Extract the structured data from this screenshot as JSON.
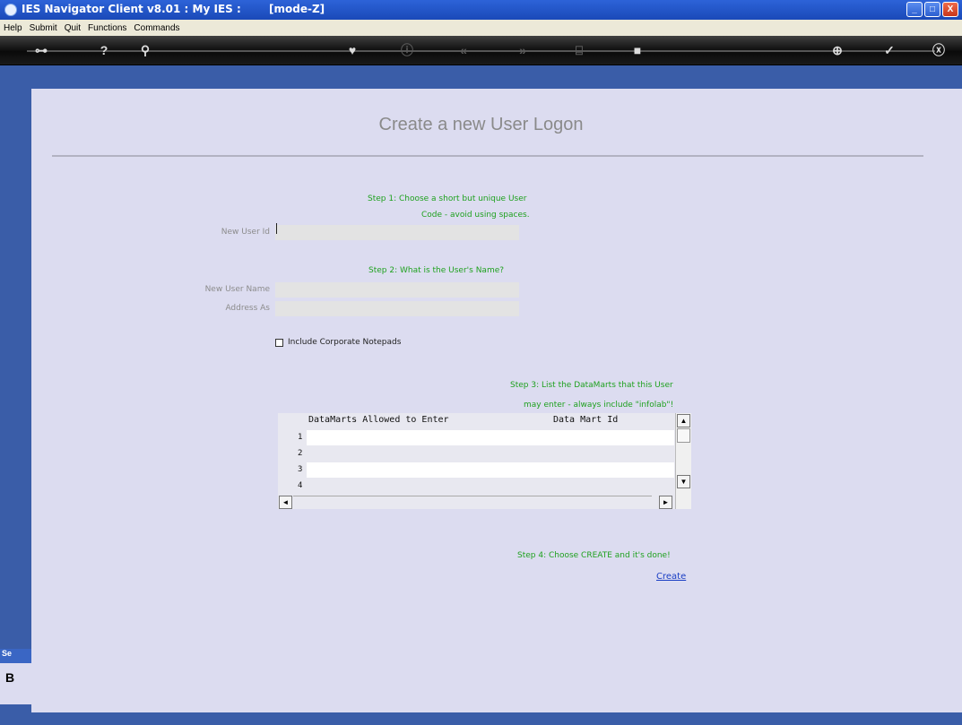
{
  "window": {
    "title": "IES Navigator Client v8.01 : My IES :",
    "mode": "[mode-Z]",
    "controls": {
      "minimize": "_",
      "maximize": "□",
      "close": "X"
    }
  },
  "menu": {
    "items": [
      "Help",
      "Submit",
      "Quit",
      "Functions",
      "Commands"
    ]
  },
  "toolbar": {
    "icons": [
      "key-icon",
      "help-icon",
      "search-icon",
      "heart-icon",
      "info-icon",
      "back-icon",
      "forward-icon",
      "tree-icon",
      "stop-icon",
      "add-icon",
      "check-icon",
      "close-icon"
    ],
    "glyphs": {
      "key": "⊶",
      "help": "?",
      "search": "⚲",
      "heart": "♥",
      "info": "ⓘ",
      "back": "«",
      "forward": "»",
      "tree": "⌸",
      "stop": "■",
      "add": "⊕",
      "check": "✓",
      "close": "ⓧ"
    }
  },
  "side_panel": {
    "header": "Se",
    "icon": "B"
  },
  "form": {
    "heading": "Create a new User Logon",
    "step1_line1": "Step 1: Choose a short but unique User",
    "step1_line2": "Code - avoid using spaces.",
    "new_user_id_label": "New User Id",
    "new_user_id_value": "",
    "step2": "Step 2: What is the User's Name?",
    "new_user_name_label": "New User Name",
    "new_user_name_value": "",
    "address_as_label": "Address As",
    "address_as_value": "",
    "include_notepads_label": "Include Corporate Notepads",
    "include_notepads_checked": false,
    "step3_line1": "Step 3: List the DataMarts that this User",
    "step3_line2": "may enter - always include \"infolab\"!",
    "grid": {
      "columns": [
        "DataMarts Allowed to Enter",
        "Data Mart Id"
      ],
      "rows": [
        {
          "num": "1",
          "value": ""
        },
        {
          "num": "2",
          "value": ""
        },
        {
          "num": "3",
          "value": ""
        },
        {
          "num": "4",
          "value": ""
        }
      ],
      "scroll_up": "▲",
      "scroll_down": "▼",
      "scroll_left": "◄",
      "scroll_right": "►"
    },
    "step4": "Step 4: Choose CREATE and it's done!",
    "create_link": "Create"
  },
  "colors": {
    "background": "#dcdcf0",
    "step_text": "#1fa11f",
    "link": "#1a3ec4",
    "title_bar": "#2d63d8",
    "toolbar": "#111111"
  }
}
